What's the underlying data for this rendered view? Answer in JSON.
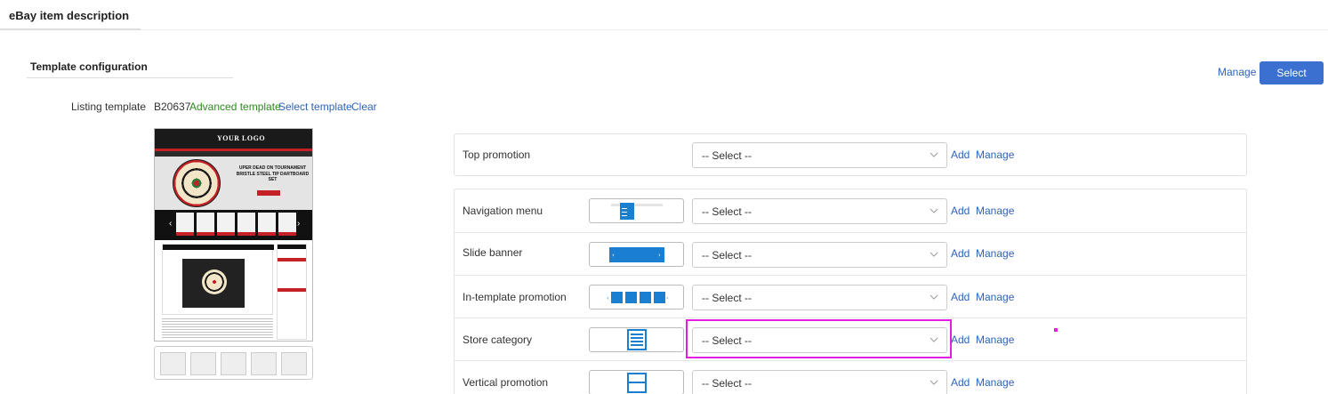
{
  "page": {
    "tab_title": "eBay item description"
  },
  "config": {
    "section_title": "Template configuration",
    "manage_label": "Manage",
    "select_button_label": "Select"
  },
  "listing_template": {
    "label": "Listing template",
    "code": "B20637",
    "name": "Advanced template",
    "select_link": "Select template",
    "clear_link": "Clear"
  },
  "preview": {
    "logo_text": "YOUR LOGO",
    "hero_text": "UPER DEAD ON TOURNAMENT BRISTLE STEEL TIP DARTBOARD SET"
  },
  "top_promotion": {
    "label": "Top promotion",
    "dropdown_value": "-- Select --",
    "add_label": "Add",
    "manage_label": "Manage"
  },
  "modules": [
    {
      "label": "Navigation menu",
      "icon": "navigation-menu-icon",
      "dropdown_value": "-- Select --",
      "add_label": "Add",
      "manage_label": "Manage"
    },
    {
      "label": "Slide banner",
      "icon": "slide-banner-icon",
      "dropdown_value": "-- Select --",
      "add_label": "Add",
      "manage_label": "Manage"
    },
    {
      "label": "In-template promotion",
      "icon": "in-template-promotion-icon",
      "dropdown_value": "-- Select --",
      "add_label": "Add",
      "manage_label": "Manage"
    },
    {
      "label": "Store category",
      "icon": "store-category-icon",
      "dropdown_value": "-- Select --",
      "add_label": "Add",
      "manage_label": "Manage"
    },
    {
      "label": "Vertical promotion",
      "icon": "vertical-promotion-icon",
      "dropdown_value": "-- Select --",
      "add_label": "Add",
      "manage_label": "Manage"
    }
  ],
  "colors": {
    "link": "#2e63b8",
    "template_name": "#2c8a1e",
    "primary_button": "#3b6fd0",
    "icon_blue": "#1a7fd0",
    "highlight": "#e21ee2"
  }
}
